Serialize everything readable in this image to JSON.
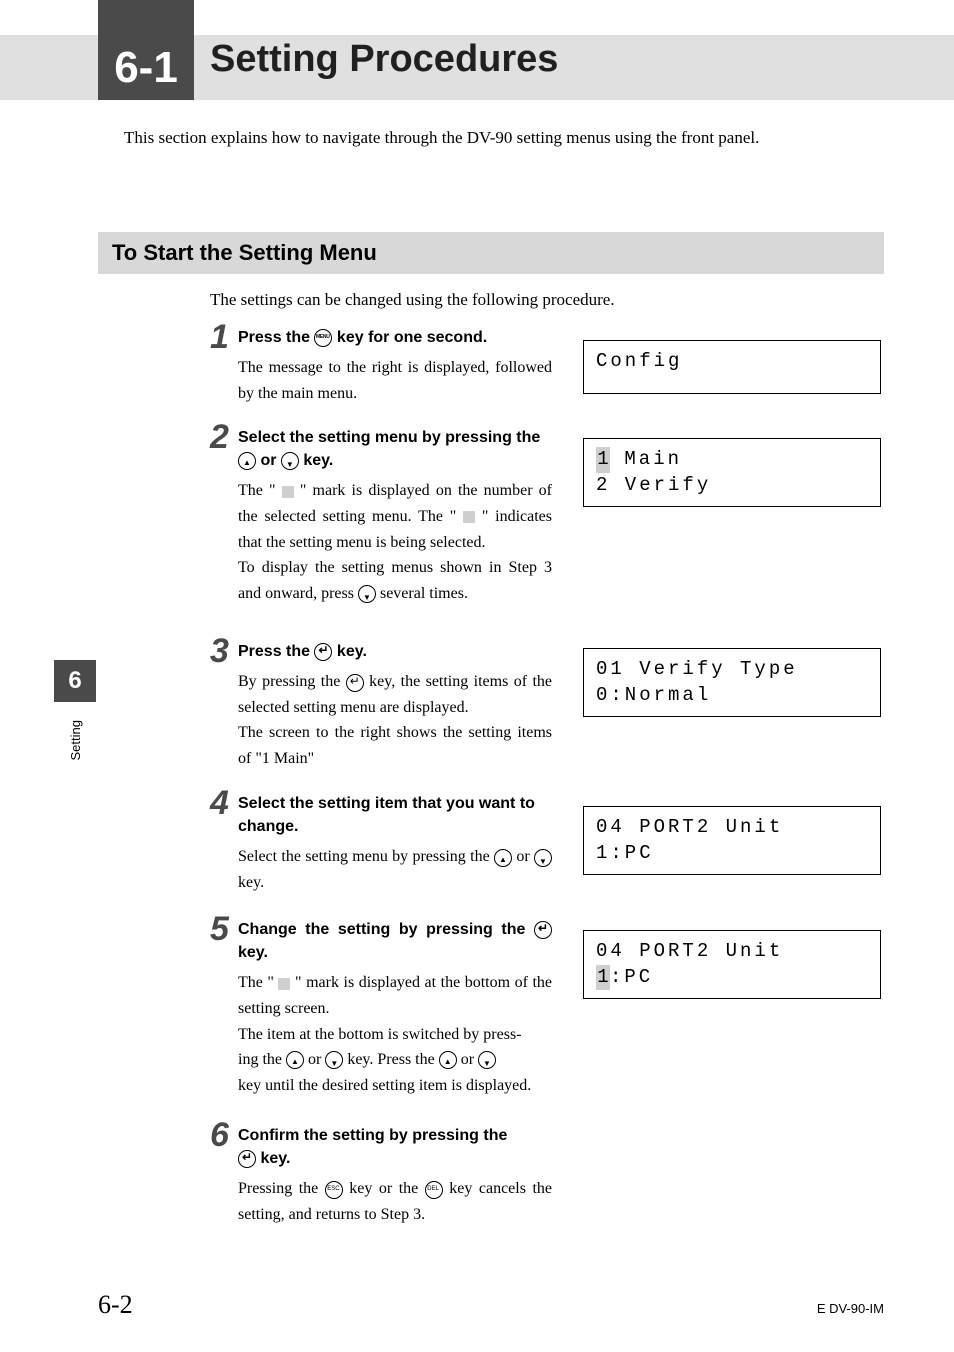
{
  "chapter": {
    "num": "6-1",
    "title": "Setting Procedures"
  },
  "intro": "This section explains how to  navigate through the DV-90 setting menus using the front panel.",
  "section": {
    "title": "To Start the Setting Menu",
    "intro": "The settings can be changed using the following procedure."
  },
  "steps": {
    "s1": {
      "num": "1",
      "title_a": "Press the ",
      "title_b": " key for one second.",
      "body": "The message to the right is displayed, followed by the main menu."
    },
    "s2": {
      "num": "2",
      "title_a": "Select the setting menu by pressing the ",
      "title_b": " or ",
      "title_c": " key.",
      "body_a": "The \" ",
      "body_b": " \" mark is displayed on the number of the selected setting menu. The \" ",
      "body_c": " \" indicates that the setting menu is being selected.",
      "body_d": "To display the setting menus shown in Step 3 and onward, press ",
      "body_e": "  several times."
    },
    "s3": {
      "num": "3",
      "title_a": "Press the ",
      "title_b": " key.",
      "body_a": "By pressing the ",
      "body_b": " key, the setting items of the selected setting menu are displayed.",
      "body_c": "The screen to the right shows the setting items of \"1 Main\""
    },
    "s4": {
      "num": "4",
      "title": "Select the setting item that you want to change.",
      "body_a": "Select the setting menu by pressing the ",
      "body_b": " or ",
      "body_c": " key."
    },
    "s5": {
      "num": "5",
      "title_a": "Change the setting by pressing the ",
      "title_b": " key.",
      "body_a": "The \" ",
      "body_b": " \" mark is displayed at the bottom of the setting screen.",
      "body_c": "The item at the bottom is switched by press-",
      "body_d": "ing the ",
      "body_e": " or ",
      "body_f": " key. Press the ",
      "body_g": " or ",
      "body_h": " key until the desired setting item is displayed."
    },
    "s6": {
      "num": "6",
      "title_a": "Confirm the setting by pressing the",
      "title_b": " key.",
      "body_a": "Pressing the ",
      "body_b": " key or the ",
      "body_c": " key cancels the setting, and returns to Step 3."
    }
  },
  "displays": {
    "d1": "Config",
    "d2_line1_hl": "1",
    "d2_line1": " Main",
    "d2_line2": "2 Verify",
    "d3_line1": "01 Verify Type",
    "d3_line2": "0:Normal",
    "d4_line1": "04 PORT2 Unit",
    "d4_line2": "1:PC",
    "d5_line1": "04 PORT2 Unit",
    "d5_line2_hl": "1",
    "d5_line2": ":PC"
  },
  "side": {
    "chapter_num": "6",
    "label": "Setting"
  },
  "footer": {
    "page": "6-2",
    "doc_code": "E DV-90-IM"
  }
}
